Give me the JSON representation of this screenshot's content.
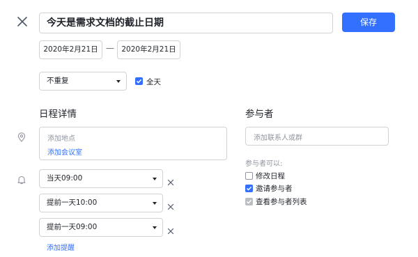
{
  "header": {
    "title_value": "今天是需求文档的截止日期",
    "save_label": "保存"
  },
  "dates": {
    "start": "2020年2月21日",
    "separator": "—",
    "end": "2020年2月21日"
  },
  "repeat": {
    "selected": "不重复"
  },
  "all_day": {
    "label": "全天",
    "checked": true
  },
  "details": {
    "title": "日程详情",
    "location_placeholder": "添加地点",
    "add_room_link": "添加会议室",
    "reminders": [
      {
        "selected": "当天09:00"
      },
      {
        "selected": "提前一天10:00"
      },
      {
        "selected": "提前一天09:00"
      }
    ],
    "add_reminder_link": "添加提醒"
  },
  "participants": {
    "title": "参与者",
    "search_placeholder": "添加联系人或群",
    "permissions_label": "参与者可以:",
    "permissions": [
      {
        "label": "修改日程",
        "state": "unchecked"
      },
      {
        "label": "邀请参与者",
        "state": "checked"
      },
      {
        "label": "查看参与者列表",
        "state": "checked-disabled"
      }
    ]
  },
  "colors": {
    "accent": "#3370ff",
    "border": "#d0d3d6",
    "placeholder": "#8f959e",
    "disabled_check": "#bbbfc4"
  }
}
